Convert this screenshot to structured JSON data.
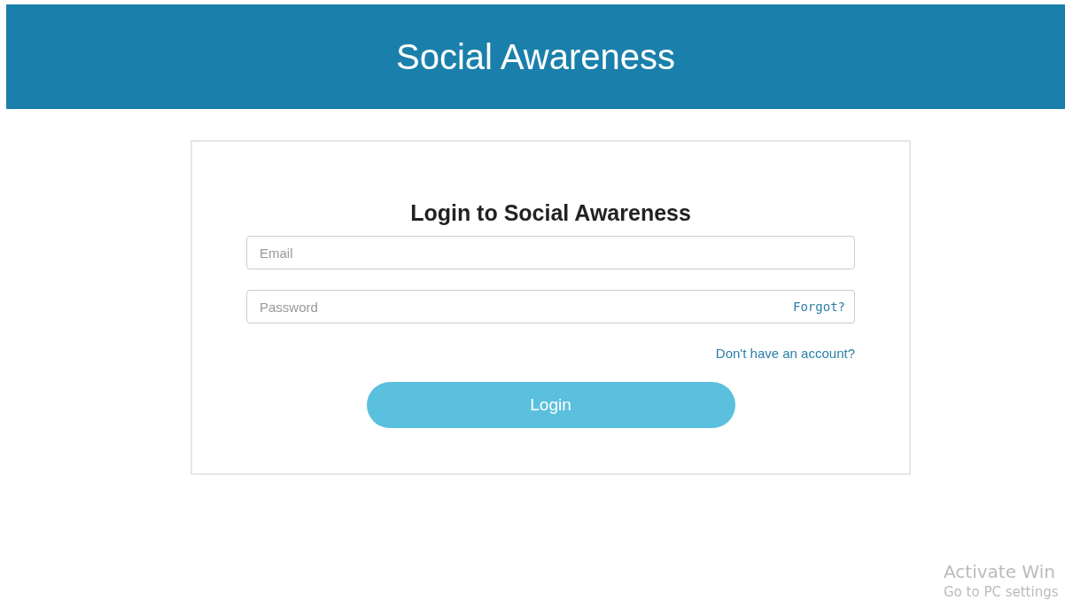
{
  "header": {
    "title": "Social Awareness"
  },
  "login_form": {
    "title": "Login to Social Awareness",
    "email": {
      "placeholder": "Email"
    },
    "password": {
      "placeholder": "Password"
    },
    "forgot_link": "Forgot?",
    "signup_link": "Don't have an account?",
    "submit_button": "Login"
  },
  "system_notice": {
    "title": "Activate Win",
    "subtitle": "Go to PC settings"
  }
}
